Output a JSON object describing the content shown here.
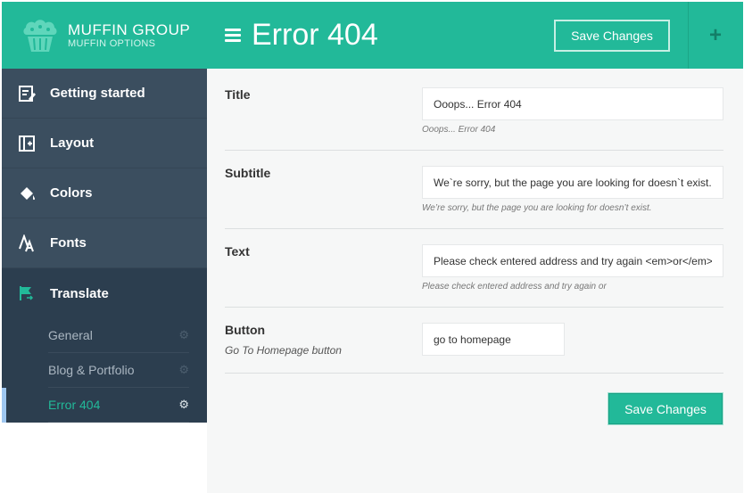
{
  "brand": {
    "name": "MUFFIN GROUP",
    "subtitle": "MUFFIN OPTIONS"
  },
  "header": {
    "title": "Error 404",
    "save_label": "Save Changes",
    "add_symbol": "+"
  },
  "sidebar": {
    "items": [
      {
        "label": "Getting started",
        "icon": "edit-icon"
      },
      {
        "label": "Layout",
        "icon": "layout-icon"
      },
      {
        "label": "Colors",
        "icon": "paint-bucket-icon"
      },
      {
        "label": "Fonts",
        "icon": "fonts-icon"
      },
      {
        "label": "Translate",
        "icon": "flag-icon"
      }
    ],
    "subitems": [
      {
        "label": "General"
      },
      {
        "label": "Blog & Portfolio"
      },
      {
        "label": "Error 404"
      }
    ],
    "gear_symbol": "⚙"
  },
  "fields": [
    {
      "label": "Title",
      "sublabel": "",
      "value": "Ooops... Error 404",
      "hint": "Ooops... Error 404"
    },
    {
      "label": "Subtitle",
      "sublabel": "",
      "value": "We`re sorry, but the page you are looking for doesn`t exist.",
      "hint": "We’re sorry, but the page you are looking for doesn’t exist."
    },
    {
      "label": "Text",
      "sublabel": "",
      "value": "Please check entered address and try again <em>or</em>",
      "hint": "Please check entered address and try again or"
    },
    {
      "label": "Button",
      "sublabel": "Go To Homepage button",
      "value": "go to homepage",
      "hint": ""
    }
  ],
  "footer": {
    "save_label": "Save Changes"
  },
  "colors": {
    "accent": "#22b999",
    "sidebar": "#3b4e5f",
    "sidebar_dark": "#2c3e4f",
    "content_bg": "#f6f7f7"
  }
}
